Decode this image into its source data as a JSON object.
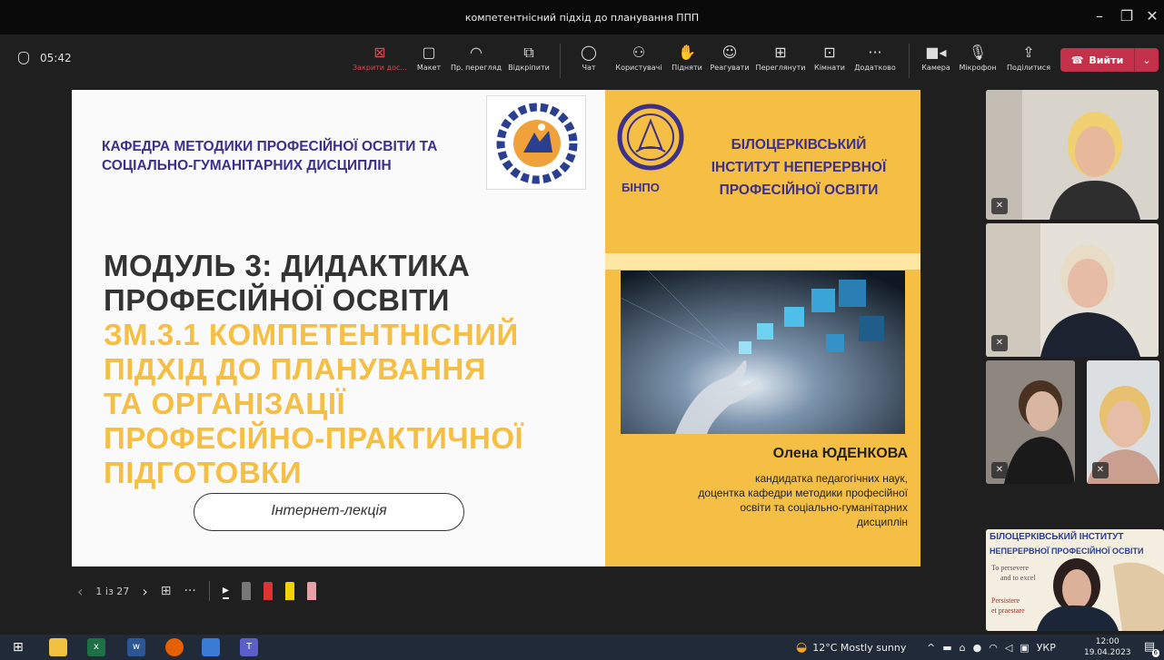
{
  "window": {
    "title": "компетентнісний підхід до планування ППП"
  },
  "meeting": {
    "timer": "05:42",
    "toolbar": [
      {
        "label": "Закрити дос...",
        "icon": "close-share-icon"
      },
      {
        "label": "Макет",
        "icon": "layout-icon"
      },
      {
        "label": "Пр. перегляд",
        "icon": "view-icon"
      },
      {
        "label": "Відкріпити",
        "icon": "popout-icon"
      },
      {
        "label": "Чат",
        "icon": "chat-icon"
      },
      {
        "label": "Користувачі",
        "icon": "people-icon"
      },
      {
        "label": "Підняти",
        "icon": "raise-hand-icon"
      },
      {
        "label": "Реагувати",
        "icon": "react-icon"
      },
      {
        "label": "Переглянути",
        "icon": "view-grid-icon"
      },
      {
        "label": "Кімнати",
        "icon": "rooms-icon"
      },
      {
        "label": "Додатково",
        "icon": "more-icon"
      },
      {
        "label": "Камера",
        "icon": "camera-icon"
      },
      {
        "label": "Мікрофон",
        "icon": "microphone-icon"
      },
      {
        "label": "Поділитися",
        "icon": "share-icon"
      }
    ],
    "leave_label": "Вийти"
  },
  "slide": {
    "dept": "КАФЕДРА МЕТОДИКИ ПРОФЕСІЙНОЇ ОСВІТИ ТА СОЦІАЛЬНО-ГУМАНІТАРНИХ ДИСЦИПЛІН",
    "institute": "БІЛОЦЕРКІВСЬКИЙ ІНСТИТУТ НЕПЕРЕРВНОЇ ПРОФЕСІЙНОЇ ОСВІТИ",
    "institute_abbr": "БІНПО",
    "logo1_text": "КАФЕДРА МПО ТА СГД БІНПО",
    "module_line1": "МОДУЛЬ 3: ДИДАКТИКА",
    "module_line2": "ПРОФЕСІЙНОЇ ОСВІТИ",
    "topic_lines": [
      "ЗМ.3.1 КОМПЕТЕНТНІСНИЙ",
      "ПІДХІД ДО  ПЛАНУВАННЯ",
      "ТА ОРГАНІЗАЦІЇ",
      "ПРОФЕСІЙНО-ПРАКТИЧНОЇ",
      "ПІДГОТОВКИ"
    ],
    "format": "Інтернет-лекція",
    "author_name": "Олена ЮДЕНКОВА",
    "author_pos": [
      "кандидатка педагогічних наук,",
      "доцентка кафедри методики професійної",
      "освіти та соціально-гуманітарних",
      "дисциплін"
    ]
  },
  "slide_controls": {
    "page": "1 із 27"
  },
  "share_thumb": {
    "line1": "БІЛОЦЕРКІВСЬКИЙ ІНСТИТУТ",
    "line2": "НЕПЕРЕРВНОЇ ПРОФЕСІЙНОЇ ОСВІТИ",
    "note1": "To persevere",
    "note2": "and to excel",
    "note3": "Persistere",
    "note4": "et praestare"
  },
  "taskbar": {
    "weather": "12°C  Mostly sunny",
    "lang": "УКР",
    "time": "12:00",
    "date": "19.04.2023",
    "notif": "6"
  }
}
